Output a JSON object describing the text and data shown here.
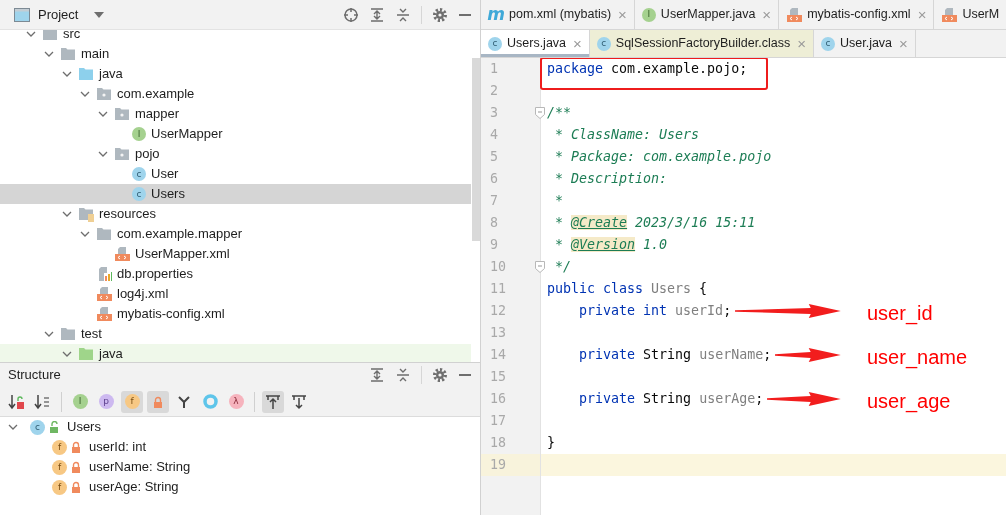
{
  "project_panel": {
    "title": "Project",
    "tree": [
      {
        "label": "src",
        "kind": "folder",
        "expanded": true,
        "selected": false,
        "children": [
          {
            "label": "main",
            "kind": "folder",
            "expanded": true,
            "selected": false,
            "children": [
              {
                "label": "java",
                "kind": "source-folder",
                "expanded": true,
                "selected": false,
                "children": [
                  {
                    "label": "com.example",
                    "kind": "package",
                    "expanded": true,
                    "selected": false,
                    "children": [
                      {
                        "label": "mapper",
                        "kind": "package",
                        "expanded": true,
                        "selected": false,
                        "children": [
                          {
                            "label": "UserMapper",
                            "kind": "interface",
                            "glyph": "I",
                            "selected": false
                          }
                        ]
                      },
                      {
                        "label": "pojo",
                        "kind": "package",
                        "expanded": true,
                        "selected": false,
                        "children": [
                          {
                            "label": "User",
                            "kind": "class",
                            "glyph": "c",
                            "selected": false
                          },
                          {
                            "label": "Users",
                            "kind": "class",
                            "glyph": "c",
                            "selected": true
                          }
                        ]
                      }
                    ]
                  }
                ]
              },
              {
                "label": "resources",
                "kind": "resources-folder",
                "expanded": true,
                "selected": false,
                "children": [
                  {
                    "label": "com.example.mapper",
                    "kind": "folder",
                    "expanded": true,
                    "selected": false,
                    "children": [
                      {
                        "label": "UserMapper.xml",
                        "kind": "xml",
                        "selected": false
                      }
                    ]
                  },
                  {
                    "label": "db.properties",
                    "kind": "properties",
                    "selected": false
                  },
                  {
                    "label": "log4j.xml",
                    "kind": "xml",
                    "selected": false
                  },
                  {
                    "label": "mybatis-config.xml",
                    "kind": "xml",
                    "selected": false
                  }
                ]
              }
            ]
          },
          {
            "label": "test",
            "kind": "folder",
            "expanded": true,
            "selected": false,
            "children": [
              {
                "label": "java",
                "kind": "test-source-folder",
                "expanded": true,
                "selected": false
              }
            ]
          }
        ]
      }
    ]
  },
  "structure_panel": {
    "title": "Structure",
    "toolbar": [
      [
        {
          "kind": "sort-visibility",
          "on": false
        },
        {
          "kind": "sort-alpha",
          "on": false
        }
      ],
      [
        {
          "kind": "inherited",
          "glyph": "I",
          "on": false
        },
        {
          "kind": "properties",
          "glyph": "p",
          "on": false
        },
        {
          "kind": "fields",
          "glyph": "f",
          "on": true
        },
        {
          "kind": "non-public",
          "on": true
        },
        {
          "kind": "branch",
          "on": false
        },
        {
          "kind": "ring",
          "on": false
        },
        {
          "kind": "lambdas",
          "glyph": "λ",
          "on": false
        }
      ],
      [
        {
          "kind": "autoscroll-from",
          "on": true
        },
        {
          "kind": "autoscroll-to",
          "on": false
        }
      ]
    ],
    "tree": [
      {
        "label": "Users",
        "kind": "class",
        "glyph": "c",
        "locked": false,
        "expanded": true,
        "selected": false,
        "children": [
          {
            "label": "userId: int",
            "kind": "field",
            "glyph": "f",
            "locked": true,
            "selected": false
          },
          {
            "label": "userName: String",
            "kind": "field",
            "glyph": "f",
            "locked": true,
            "selected": false
          },
          {
            "label": "userAge: String",
            "kind": "field",
            "glyph": "f",
            "locked": true,
            "selected": false
          }
        ]
      }
    ]
  },
  "editor": {
    "tab_rows": [
      [
        {
          "label": "pom.xml (mybatis)",
          "kind": "maven",
          "glyph": "m",
          "close": "×",
          "selected": false,
          "library": false
        },
        {
          "label": "UserMapper.java",
          "kind": "interface",
          "glyph": "I",
          "close": "×",
          "selected": false,
          "library": false
        },
        {
          "label": "mybatis-config.xml",
          "kind": "xml",
          "close": "×",
          "selected": false,
          "library": false
        },
        {
          "label": "UserM",
          "kind": "xml",
          "selected": false,
          "library": false
        }
      ],
      [
        {
          "label": "Users.java",
          "kind": "class",
          "glyph": "c",
          "close": "×",
          "selected": true,
          "library": false
        },
        {
          "label": "SqlSessionFactoryBuilder.class",
          "kind": "class",
          "glyph": "c",
          "close": "×",
          "selected": false,
          "library": true
        },
        {
          "label": "User.java",
          "kind": "class",
          "glyph": "c",
          "close": "×",
          "selected": false,
          "library": false
        }
      ]
    ],
    "lines": [
      {
        "number": "1",
        "fold": false,
        "current": false,
        "tokens": [
          {
            "kind": "keyword",
            "text": "package"
          },
          {
            "kind": "plain",
            "text": " com.example.pojo;"
          }
        ],
        "note": {
          "kind": "box"
        }
      },
      {
        "number": "2",
        "fold": false,
        "current": false
      },
      {
        "number": "3",
        "fold": true,
        "current": false,
        "tokens": [
          {
            "kind": "doc",
            "text": "/**"
          }
        ]
      },
      {
        "number": "4",
        "fold": false,
        "current": false,
        "tokens": [
          {
            "kind": "doc",
            "text": " * ClassName: Users"
          }
        ]
      },
      {
        "number": "5",
        "fold": false,
        "current": false,
        "tokens": [
          {
            "kind": "doc",
            "text": " * Package: com.example.pojo"
          }
        ]
      },
      {
        "number": "6",
        "fold": false,
        "current": false,
        "tokens": [
          {
            "kind": "doc",
            "text": " * Description:"
          }
        ]
      },
      {
        "number": "7",
        "fold": false,
        "current": false,
        "tokens": [
          {
            "kind": "doc",
            "text": " *"
          }
        ]
      },
      {
        "number": "8",
        "fold": false,
        "current": false,
        "tokens": [
          {
            "kind": "doc",
            "text": " * "
          },
          {
            "kind": "doc-tag",
            "text": "@Create"
          },
          {
            "kind": "doc",
            "text": " 2023/3/16 15:11"
          }
        ]
      },
      {
        "number": "9",
        "fold": false,
        "current": false,
        "tokens": [
          {
            "kind": "doc",
            "text": " * "
          },
          {
            "kind": "doc-tag",
            "text": "@Version"
          },
          {
            "kind": "doc",
            "text": " 1.0"
          }
        ]
      },
      {
        "number": "10",
        "fold": true,
        "current": false,
        "tokens": [
          {
            "kind": "doc",
            "text": " */"
          }
        ]
      },
      {
        "number": "11",
        "fold": false,
        "current": false,
        "tokens": [
          {
            "kind": "keyword",
            "text": "public class "
          },
          {
            "kind": "unused",
            "text": "Users"
          },
          {
            "kind": "plain",
            "text": " {"
          }
        ]
      },
      {
        "number": "12",
        "fold": false,
        "current": false,
        "tokens": [
          {
            "kind": "keyword",
            "text": "    private int "
          },
          {
            "kind": "unused",
            "text": "userId"
          },
          {
            "kind": "plain",
            "text": ";"
          }
        ],
        "note": {
          "kind": "arrow",
          "label": "user_id"
        }
      },
      {
        "number": "13",
        "fold": false,
        "current": false
      },
      {
        "number": "14",
        "fold": false,
        "current": false,
        "tokens": [
          {
            "kind": "keyword",
            "text": "    private "
          },
          {
            "kind": "plain",
            "text": "String "
          },
          {
            "kind": "unused",
            "text": "userName"
          },
          {
            "kind": "plain",
            "text": ";"
          }
        ],
        "note": {
          "kind": "arrow",
          "label": "user_name"
        }
      },
      {
        "number": "15",
        "fold": false,
        "current": false
      },
      {
        "number": "16",
        "fold": false,
        "current": false,
        "tokens": [
          {
            "kind": "keyword",
            "text": "    private "
          },
          {
            "kind": "plain",
            "text": "String "
          },
          {
            "kind": "unused",
            "text": "userAge"
          },
          {
            "kind": "plain",
            "text": ";"
          }
        ],
        "note": {
          "kind": "arrow",
          "label": "user_age"
        }
      },
      {
        "number": "17",
        "fold": false,
        "current": false
      },
      {
        "number": "18",
        "fold": false,
        "current": false,
        "tokens": [
          {
            "kind": "plain",
            "text": "}"
          }
        ]
      },
      {
        "number": "19",
        "fold": false,
        "current": true
      }
    ]
  }
}
